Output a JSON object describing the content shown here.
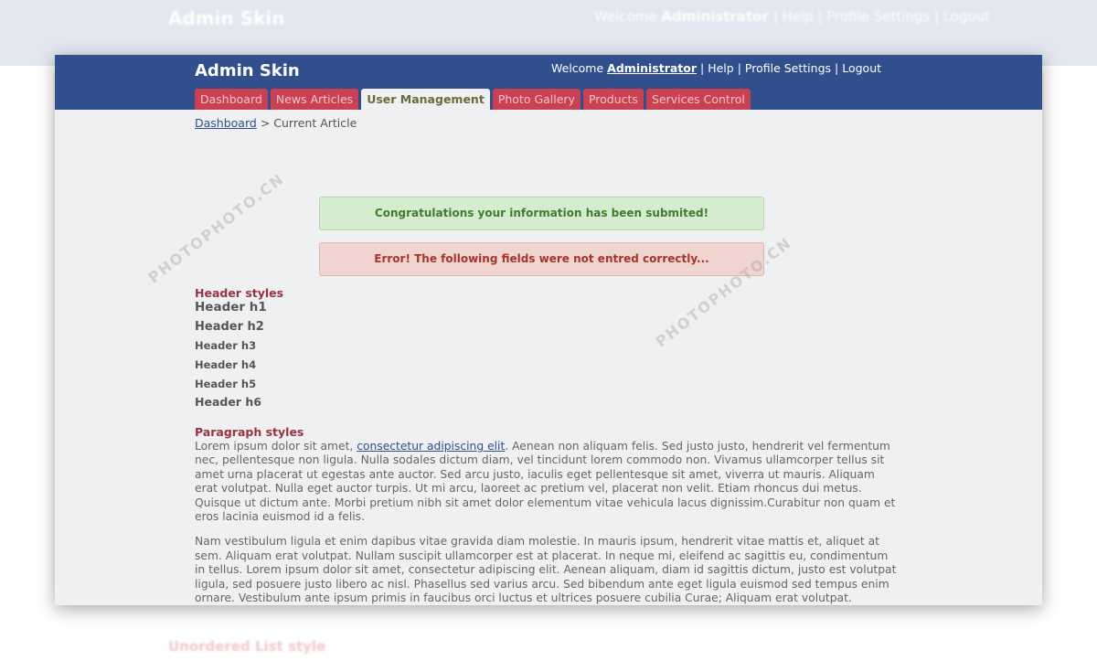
{
  "app": {
    "title": "Admin Skin"
  },
  "userbar": {
    "welcome": "Welcome",
    "user": "Administrator",
    "help": "Help",
    "profile": "Profile Settings",
    "logout": "Logout",
    "sep": "|"
  },
  "tabs": [
    {
      "label": "Dashboard"
    },
    {
      "label": "News Articles"
    },
    {
      "label": "User Management",
      "active": true
    },
    {
      "label": "Photo Gallery"
    },
    {
      "label": "Products"
    },
    {
      "label": "Services Control"
    }
  ],
  "breadcrumb": {
    "home": "Dashboard",
    "sep": ">",
    "current": "Current Article"
  },
  "messages": {
    "success": "Congratulations your information has been submited!",
    "error": "Error! The following fields were not entred correctly..."
  },
  "headers": {
    "title": "Header styles",
    "items": [
      "Header h1",
      "Header h2",
      "Header h3",
      "Header h4",
      "Header h5",
      "Header h6"
    ]
  },
  "paragraphs": {
    "title": "Paragraph styles",
    "p1_start": "Lorem ipsum dolor sit amet, ",
    "p1_link": "consectetur adipiscing elit",
    "p1_rest": ". Aenean non aliquam felis. Sed justo justo, hendrerit vel fermentum nec, pellentesque non ligula. Nulla sodales dictum diam, vel tincidunt lorem commodo non. Vivamus ullamcorper tellus sit amet urna placerat ut egestas ante auctor. Sed arcu justo, iaculis eget pellentesque sit amet, viverra ut mauris. Aliquam erat volutpat. Nulla eget auctor turpis. Ut mi arcu, laoreet ac pretium vel, placerat non velit. Etiam rhoncus dui metus. Quisque ut dictum ante. Morbi pretium nibh sit amet dolor elementum vitae vehicula lacus dignissim.Curabitur non quam et eros lacinia euismod id a felis.",
    "p2": "Nam vestibulum ligula et enim dapibus vitae gravida diam molestie. In mauris ipsum, hendrerit vitae mattis et, aliquet at sem. Aliquam erat volutpat. Nullam suscipit ullamcorper est at placerat. In neque mi, eleifend ac sagittis eu, condimentum in tellus. Lorem ipsum dolor sit amet, consectetur adipiscing elit. Aenean aliquam, diam id sagittis dictum, justo est volutpat ligula, sed posuere justo libero ac nisl. Phasellus sed varius arcu. Sed bibendum ante eget ligula euismod sed tempus enim ornare. Vestibulum ante ipsum primis in faucibus orci luctus et ultrices posuere cubilia Curae; Aliquam erat volutpat."
  },
  "lists": {
    "title": "Unordered List style"
  },
  "watermark": "PHOTOPHOTO.CN",
  "colors": {
    "header": "#304f8c",
    "tab": "#c94152",
    "section": "#993344",
    "success": "#d5ecd0",
    "error": "#f0d4cf"
  }
}
